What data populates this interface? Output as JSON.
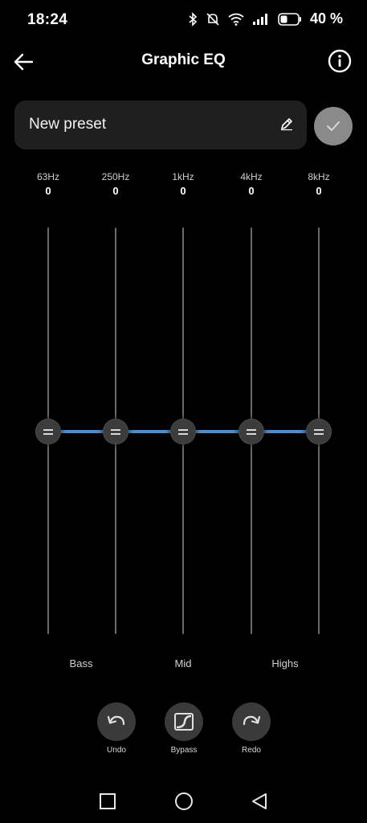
{
  "status_bar": {
    "time": "18:24",
    "battery_percent": "40 %",
    "icons": [
      "bluetooth-icon",
      "notifications-muted-icon",
      "wifi-icon",
      "signal-icon",
      "battery-icon"
    ]
  },
  "header": {
    "title": "Graphic EQ",
    "back_icon": "arrow-left-icon",
    "info_icon": "info-icon"
  },
  "preset": {
    "name": "New preset",
    "edit_icon": "pencil-icon",
    "confirm_icon": "checkmark-icon"
  },
  "bands": [
    {
      "freq": "63Hz",
      "gain": "0"
    },
    {
      "freq": "250Hz",
      "gain": "0"
    },
    {
      "freq": "1kHz",
      "gain": "0"
    },
    {
      "freq": "4kHz",
      "gain": "0"
    },
    {
      "freq": "8kHz",
      "gain": "0"
    }
  ],
  "ranges": {
    "bass": "Bass",
    "mid": "Mid",
    "highs": "Highs"
  },
  "actions": {
    "undo": "Undo",
    "bypass": "Bypass",
    "redo": "Redo"
  },
  "colors": {
    "background": "#000000",
    "eq_line": "#4a90d0",
    "field": "#1f1f1f",
    "confirm": "#8a8a8a"
  }
}
